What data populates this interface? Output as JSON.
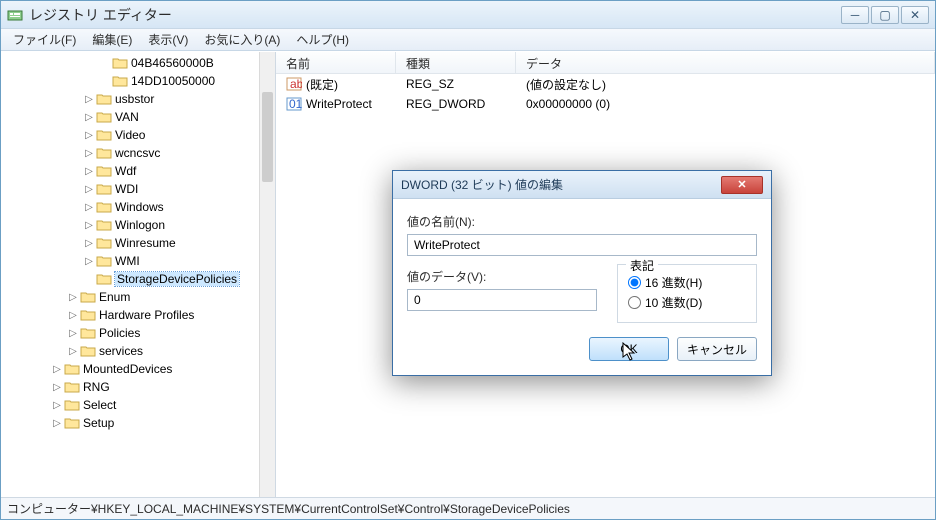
{
  "window": {
    "title": "レジストリ エディター"
  },
  "menu": {
    "file": "ファイル(F)",
    "edit": "編集(E)",
    "view": "表示(V)",
    "fav": "お気に入り(A)",
    "help": "ヘルプ(H)"
  },
  "tree": [
    {
      "expander": "",
      "label": "04B46560000B",
      "depth": 6
    },
    {
      "expander": "",
      "label": "14DD10050000",
      "depth": 6
    },
    {
      "expander": "▷",
      "label": "usbstor",
      "depth": 5
    },
    {
      "expander": "▷",
      "label": "VAN",
      "depth": 5
    },
    {
      "expander": "▷",
      "label": "Video",
      "depth": 5
    },
    {
      "expander": "▷",
      "label": "wcncsvc",
      "depth": 5
    },
    {
      "expander": "▷",
      "label": "Wdf",
      "depth": 5
    },
    {
      "expander": "▷",
      "label": "WDI",
      "depth": 5
    },
    {
      "expander": "▷",
      "label": "Windows",
      "depth": 5
    },
    {
      "expander": "▷",
      "label": "Winlogon",
      "depth": 5
    },
    {
      "expander": "▷",
      "label": "Winresume",
      "depth": 5
    },
    {
      "expander": "▷",
      "label": "WMI",
      "depth": 5
    },
    {
      "expander": "",
      "label": "StorageDevicePolicies",
      "depth": 5,
      "selected": true
    },
    {
      "expander": "▷",
      "label": "Enum",
      "depth": 4
    },
    {
      "expander": "▷",
      "label": "Hardware Profiles",
      "depth": 4
    },
    {
      "expander": "▷",
      "label": "Policies",
      "depth": 4
    },
    {
      "expander": "▷",
      "label": "services",
      "depth": 4
    },
    {
      "expander": "▷",
      "label": "MountedDevices",
      "depth": 3
    },
    {
      "expander": "▷",
      "label": "RNG",
      "depth": 3
    },
    {
      "expander": "▷",
      "label": "Select",
      "depth": 3
    },
    {
      "expander": "▷",
      "label": "Setup",
      "depth": 3
    }
  ],
  "list": {
    "col_name": "名前",
    "col_type": "種類",
    "col_data": "データ",
    "rows": [
      {
        "icon": "sz",
        "name": "(既定)",
        "type": "REG_SZ",
        "data": "(値の設定なし)"
      },
      {
        "icon": "dw",
        "name": "WriteProtect",
        "type": "REG_DWORD",
        "data": "0x00000000 (0)"
      }
    ]
  },
  "status": "コンピューター¥HKEY_LOCAL_MACHINE¥SYSTEM¥CurrentControlSet¥Control¥StorageDevicePolicies",
  "dialog": {
    "title": "DWORD (32 ビット) 値の編集",
    "name_label": "値の名前(N):",
    "name_value": "WriteProtect",
    "data_label": "値のデータ(V):",
    "data_value": "0",
    "radix_label": "表記",
    "radix_hex": "16 進数(H)",
    "radix_dec": "10 進数(D)",
    "ok": "OK",
    "cancel": "キャンセル"
  }
}
